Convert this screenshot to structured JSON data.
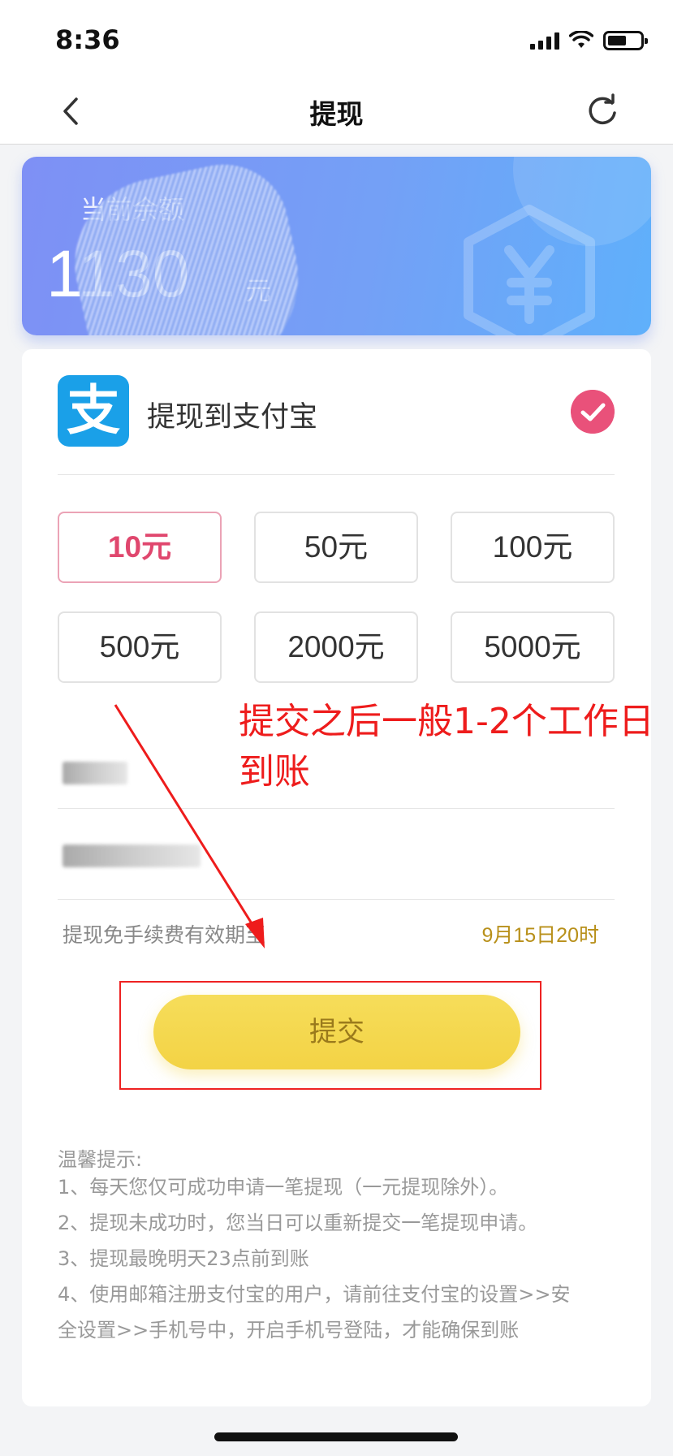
{
  "status": {
    "time": "8:36"
  },
  "nav": {
    "title": "提现"
  },
  "balance": {
    "label": "当前余额",
    "amount": "1130",
    "unit": "元"
  },
  "payment": {
    "logo_char": "支",
    "label": "提现到支付宝"
  },
  "amounts": [
    {
      "label": "10元",
      "selected": true
    },
    {
      "label": "50元",
      "selected": false
    },
    {
      "label": "100元",
      "selected": false
    },
    {
      "label": "500元",
      "selected": false
    },
    {
      "label": "2000元",
      "selected": false
    },
    {
      "label": "5000元",
      "selected": false
    }
  ],
  "fee": {
    "label": "提现免手续费有效期至",
    "date": "9月15日20时"
  },
  "submit": {
    "label": "提交"
  },
  "annotation": {
    "line1": "提交之后一般1-2个工作日",
    "line2": "到账"
  },
  "tips": {
    "title": "温馨提示:",
    "items": [
      "1、每天您仅可成功申请一笔提现（一元提现除外）。",
      "2、提现未成功时，您当日可以重新提交一笔提现申请。",
      "3、提现最晚明天23点前到账",
      "4、使用邮箱注册支付宝的用户，请前往支付宝的设置>>安",
      "全设置>>手机号中，开启手机号登陆，才能确保到账"
    ]
  },
  "colors": {
    "accent": "#e0476e",
    "submit": "#f3d345",
    "annotation": "#ee1c1c"
  }
}
